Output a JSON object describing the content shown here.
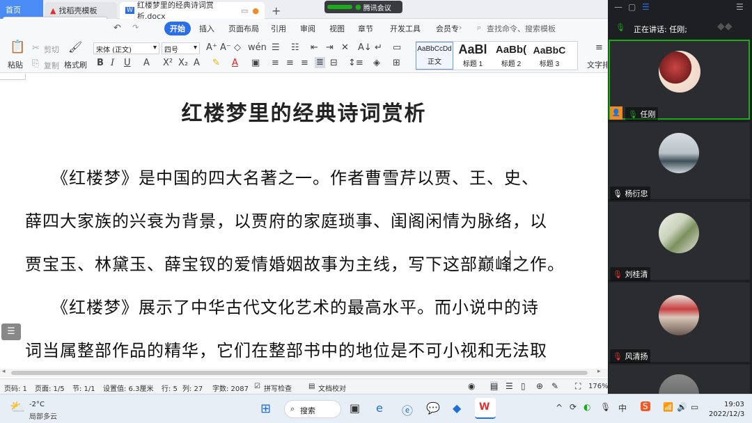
{
  "tabs": [
    {
      "label": "首页"
    },
    {
      "label": "找稻壳模板"
    },
    {
      "label": "红楼梦里的经典诗词赏析.docx"
    }
  ],
  "meeting_badge": "腾讯会议",
  "menu": [
    "开始",
    "插入",
    "页面布局",
    "引用",
    "审阅",
    "视图",
    "章节",
    "开发工具",
    "会员专"
  ],
  "search_placeholder": "查找命令、搜索模板",
  "toolbar": {
    "paste": "粘贴",
    "cut": "剪切",
    "copy": "复制",
    "format_painter": "格式刷",
    "font": "宋体 (正文)",
    "size": "四号",
    "text_layout": "文字排"
  },
  "styles": [
    {
      "preview": "AaBbCcDd",
      "name": "正文"
    },
    {
      "preview": "AaBl",
      "name": "标题 1"
    },
    {
      "preview": "AaBb(",
      "name": "标题 2"
    },
    {
      "preview": "AaBbC",
      "name": "标题 3"
    }
  ],
  "document": {
    "title": "红楼梦里的经典诗词赏析",
    "lines": [
      "　　《红楼梦》是中国的四大名著之一。作者曹雪芹以贾、王、史、",
      "薛四大家族的兴衰为背景，以贾府的家庭琐事、闺阁闲情为脉络，以",
      "贾宝玉、林黛玉、薛宝钗的爱情婚姻故事为主线，写下这部巅峰之作。",
      "　　《红楼梦》展示了中华古代文化艺术的最高水平。而小说中的诗",
      "词当属整部作品的精华，它们在整部书中的地位是不可小视和无法取"
    ]
  },
  "status": {
    "page": "页码: 1",
    "pages": "页面: 1/5",
    "section": "节: 1/1",
    "setting": "设置值: 6.3厘米",
    "row": "行: 5",
    "col": "列: 27",
    "words": "字数: 2087",
    "spell": "拼写检查",
    "proof": "文档校对",
    "zoom": "176%"
  },
  "meeting": {
    "speaking": "正在讲话: 任刚;",
    "participants": [
      {
        "name": "任刚"
      },
      {
        "name": "杨衍忠"
      },
      {
        "name": "刘桂清"
      },
      {
        "name": "风清扬"
      }
    ]
  },
  "taskbar": {
    "weather_temp": "-2°C",
    "weather_desc": "局部多云",
    "search": "搜索",
    "ime": "中",
    "time": "19:03",
    "date": "2022/12/3"
  },
  "ime_bar": {
    "lang": "中"
  },
  "colors": {
    "accent": "#2b6fe8",
    "meeting_bg": "#1e1f22",
    "active_tile_border": "#1aad19"
  }
}
